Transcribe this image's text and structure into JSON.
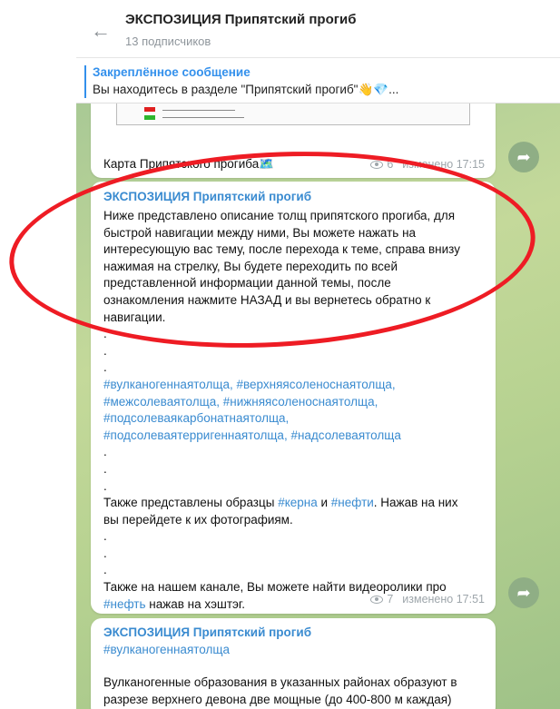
{
  "header": {
    "title": "ЭКСПОЗИЦИЯ Припятский прогиб",
    "subscribers": "13 подписчиков"
  },
  "pinned": {
    "title": "Закреплённое сообщение",
    "text": "Вы находитесь в разделе \"Припятский прогиб\"👋💎..."
  },
  "messages": [
    {
      "caption": "Карта Припятского прогиба🗺️",
      "views": "6",
      "edited": "изменено 17:15"
    },
    {
      "author": "ЭКСПОЗИЦИЯ Припятский прогиб",
      "para1": [
        "Ниже представлено описание толщ припятского прогиба, для",
        "быстрой навигации между ними, Вы можете нажать на",
        "интересующую вас тему, после перехода к теме, справа внизу",
        "нажимая на стрелку, Вы будете переходить по всей",
        "представленной информации данной темы, после",
        "ознакомления нажмите НАЗАД и вы вернетесь обратно к",
        "навигации."
      ],
      "hashtags": [
        "#вулканогеннаятолща, #верхняясоленоснаятолща,",
        "#межсолеваятолща, #нижняясоленоснаятолща,",
        "#подсолеваякарбонатнаятолща,",
        "#подсолеваятерригеннаятолща, #надсолеваятолща"
      ],
      "para2_pre": "Также представлены образцы ",
      "para2_tag1": "#керна",
      "para2_mid": " и ",
      "para2_tag2": "#нефти",
      "para2_post": ". Нажав на них",
      "para2_line2": "вы перейдете к их фотографиям.",
      "para3_line1": "Также на нашем канале, Вы можете найти видеоролики про",
      "para3_tag": "#нефть",
      "para3_post": " нажав на хэштэг.",
      "views": "7",
      "edited": "изменено 17:51"
    },
    {
      "author": "ЭКСПОЗИЦИЯ Припятский прогиб",
      "tag": "#вулканогеннаятолща",
      "line1": "Вулканогенные образования в указанных районах образуют в",
      "line2": "разрезе верхнего девона две мощные (до 400-800 м каждая)"
    }
  ],
  "dot": ".",
  "icons": {
    "back": "arrow-left-icon",
    "views": "eye-icon",
    "share": "share-arrow-icon"
  },
  "colors": {
    "accent": "#3390ec",
    "author": "#3a8bd0",
    "highlight": "#ee1c24"
  }
}
